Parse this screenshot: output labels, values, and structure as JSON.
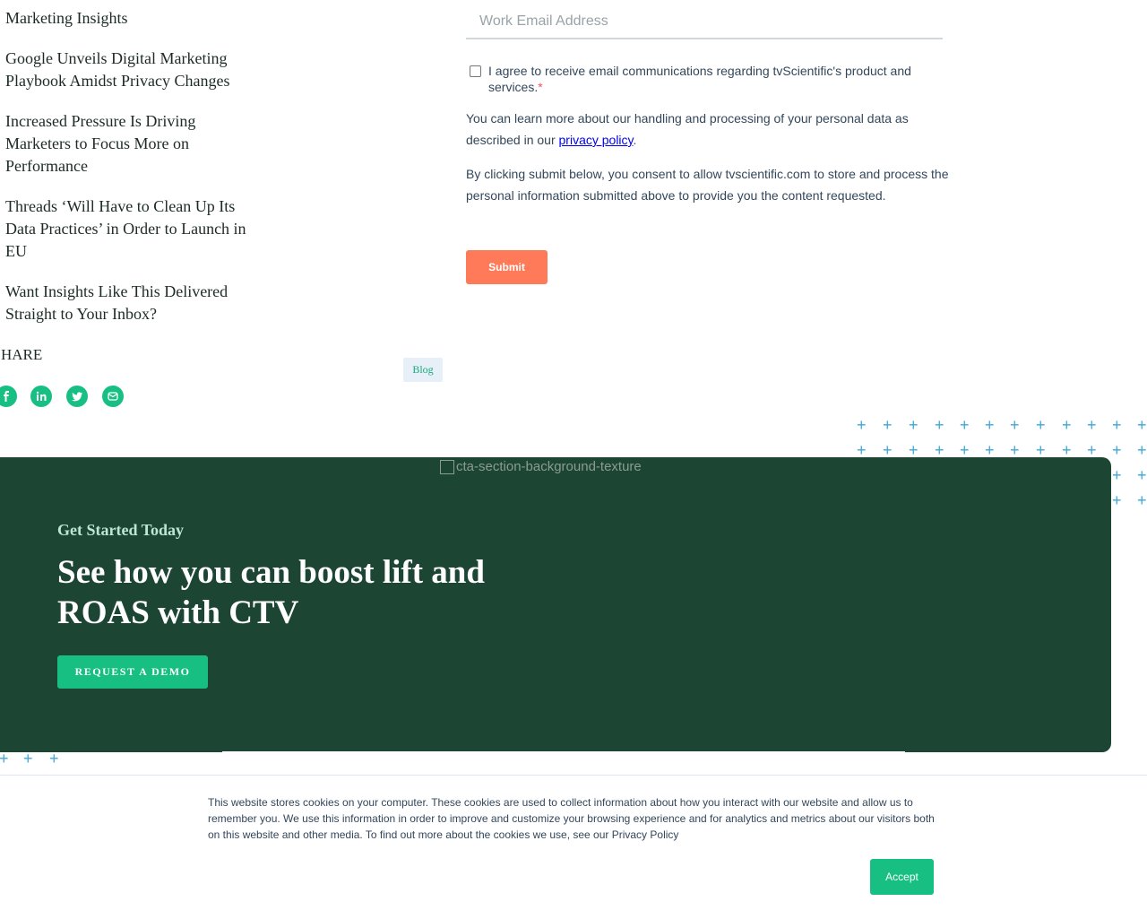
{
  "related": {
    "heading": "Marketing Insights",
    "links": [
      "Google Unveils Digital Marketing Playbook Amidst Privacy Changes",
      "Increased Pressure Is Driving Marketers to Focus More on Performance",
      "Threads ‘Will Have to Clean Up Its Data Practices’ in Order to Launch in EU",
      "Want Insights Like This Delivered Straight to Your Inbox?"
    ]
  },
  "share": {
    "label": "HARE",
    "icons": [
      "facebook-icon",
      "linkedin-icon",
      "twitter-icon",
      "email-icon"
    ]
  },
  "tag": {
    "label": "Blog"
  },
  "form": {
    "email_placeholder": "Work Email Address",
    "consent_text": "I agree to receive email communications regarding tvScientific's product and services.",
    "consent_required_mark": "*",
    "privacy_prefix": "You can learn more about our handling and processing of your personal data as described in our ",
    "privacy_link": "privacy policy",
    "privacy_suffix": ".",
    "submit_notice": "By clicking submit below, you consent to allow tvscientific.com to store and process the personal information submitted above to provide you the content requested.",
    "submit_label": "Submit"
  },
  "cta": {
    "image_alt": "cta-section-background-texture",
    "eyebrow": "Get Started Today",
    "title": "See how you can boost lift and ROAS with CTV",
    "button_label": "REQUEST A DEMO"
  },
  "cookie": {
    "text": "This website stores cookies on your computer. These cookies are used to collect information about how you interact with our website and allow us to remember you. We use this information in order to improve and customize your browsing experience and for analytics and metrics about our visitors both on this website and other media. To find out more about the cookies we use, see our Privacy Policy",
    "accept_label": "Accept"
  },
  "colors": {
    "accent_green": "#17bf83",
    "cta_background": "#1d4534",
    "submit_orange": "#ff7a59",
    "plus_blue": "#3fa7d6"
  }
}
